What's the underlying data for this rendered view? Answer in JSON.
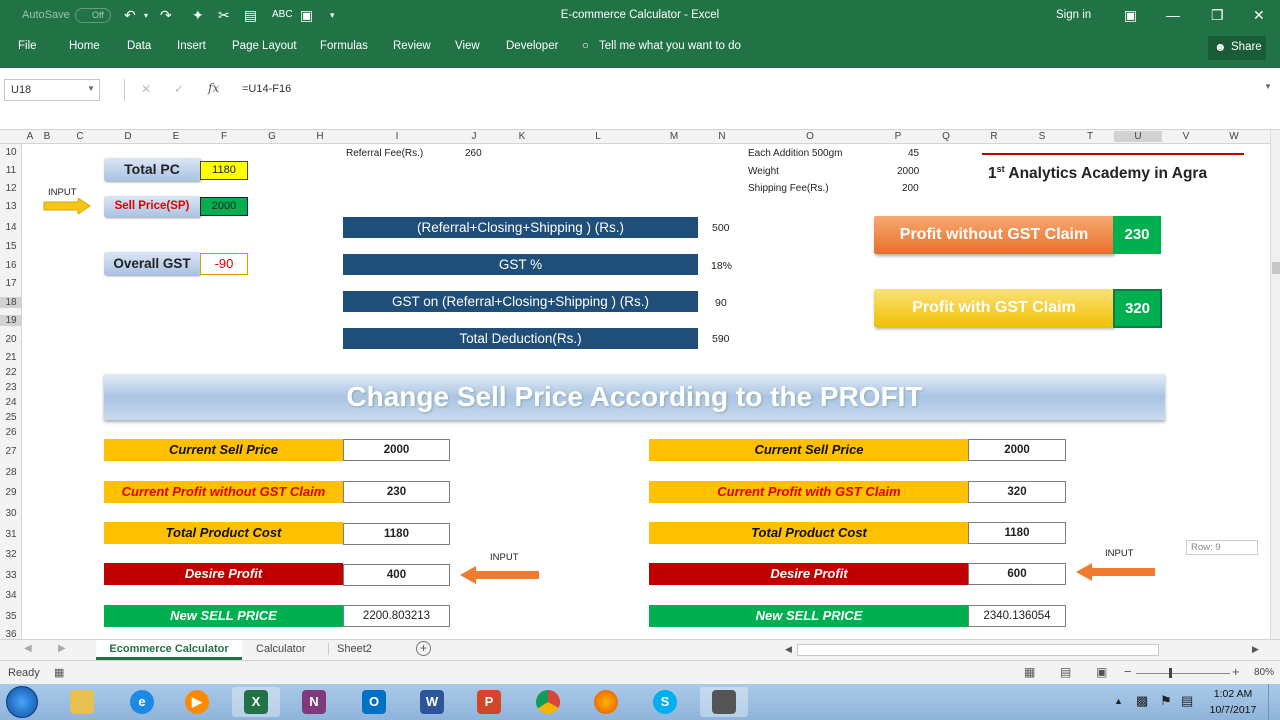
{
  "window": {
    "autosave": "AutoSave",
    "autosave_state": "Off",
    "title": "E-commerce Calculator  -  Excel",
    "sign_in": "Sign in"
  },
  "ribbon": {
    "tabs": [
      "File",
      "Home",
      "Data",
      "Insert",
      "Page Layout",
      "Formulas",
      "Review",
      "View",
      "Developer"
    ],
    "tell_me": "Tell me what you want to do",
    "share": "Share"
  },
  "formula_bar": {
    "name_box": "U18",
    "formula": "=U14-F16"
  },
  "columns": [
    "A",
    "B",
    "C",
    "D",
    "E",
    "F",
    "G",
    "H",
    "I",
    "J",
    "K",
    "L",
    "M",
    "N",
    "O",
    "P",
    "Q",
    "R",
    "S",
    "T",
    "U",
    "V",
    "W"
  ],
  "rows": [
    "10",
    "11",
    "12",
    "13",
    "14",
    "15",
    "16",
    "17",
    "18",
    "19",
    "20",
    "21",
    "22",
    "23",
    "24",
    "25",
    "26",
    "27",
    "28",
    "29",
    "30",
    "31",
    "32",
    "33",
    "34",
    "35",
    "36"
  ],
  "sheet": {
    "total_pc_label": "Total PC",
    "total_pc_value": "1180",
    "input_label_left": "INPUT",
    "sell_price_label": "Sell Price(SP)",
    "sell_price_value": "2000",
    "overall_gst_label": "Overall GST",
    "overall_gst_value": "-90",
    "referral_fee_label": "Referral Fee(Rs.)",
    "referral_fee_value": "260",
    "each_addition_label": "Each Addition 500gm",
    "each_addition_value": "45",
    "weight_label": "Weight",
    "weight_value": "2000",
    "shipping_fee_label": "Shipping Fee(Rs.)",
    "shipping_fee_value": "200",
    "academy_text": "Analytics Academy in Agra",
    "academy_num": "1",
    "academy_sup": "st",
    "deductions": [
      {
        "label": "(Referral+Closing+Shipping ) (Rs.)",
        "value": "500"
      },
      {
        "label": "GST %",
        "value": "18%"
      },
      {
        "label": "GST on (Referral+Closing+Shipping ) (Rs.)",
        "value": "90"
      },
      {
        "label": "Total Deduction(Rs.)",
        "value": "590"
      }
    ],
    "profit_without_gst_label": "Profit without GST Claim",
    "profit_without_gst_value": "230",
    "profit_with_gst_label": "Profit with GST Claim",
    "profit_with_gst_value": "320",
    "banner": "Change Sell Price According to the PROFIT",
    "left_table": {
      "current_sell_price_label": "Current Sell Price",
      "current_sell_price_value": "2000",
      "current_profit_label": "Current Profit without GST Claim",
      "current_profit_value": "230",
      "total_product_cost_label": "Total Product Cost",
      "total_product_cost_value": "1180",
      "desire_profit_label": "Desire Profit",
      "desire_profit_value": "400",
      "new_sell_price_label": "New SELL PRICE",
      "new_sell_price_value": "2200.803213",
      "input_label": "INPUT"
    },
    "right_table": {
      "current_sell_price_label": "Current Sell Price",
      "current_sell_price_value": "2000",
      "current_profit_label": "Current Profit with GST Claim",
      "current_profit_value": "320",
      "total_product_cost_label": "Total Product Cost",
      "total_product_cost_value": "1180",
      "desire_profit_label": "Desire Profit",
      "desire_profit_value": "600",
      "new_sell_price_label": "New SELL PRICE",
      "new_sell_price_value": "2340.136054",
      "input_label": "INPUT"
    },
    "row_tooltip": "Row: 9"
  },
  "sheet_tabs": [
    "Ecommerce Calculator",
    "Calculator",
    "Sheet2"
  ],
  "active_sheet": "Ecommerce Calculator",
  "status": {
    "ready": "Ready",
    "zoom": "80%"
  },
  "taskbar": {
    "time": "1:02 AM",
    "date": "10/7/2017",
    "apps": [
      "explorer-icon",
      "ie-icon",
      "media-player-icon",
      "excel-icon",
      "onenote-icon",
      "outlook-icon",
      "word-icon",
      "powerpoint-icon",
      "chrome-icon",
      "firefox-icon",
      "skype-icon",
      "screen-recorder-icon"
    ]
  },
  "colors": {
    "excel_green": "#217346",
    "deduction_blue": "#1f4e79",
    "label_yellow": "#ffc000",
    "desire_red": "#c00000",
    "new_price_green": "#00b050",
    "profit_orange": "#ed7d31"
  }
}
